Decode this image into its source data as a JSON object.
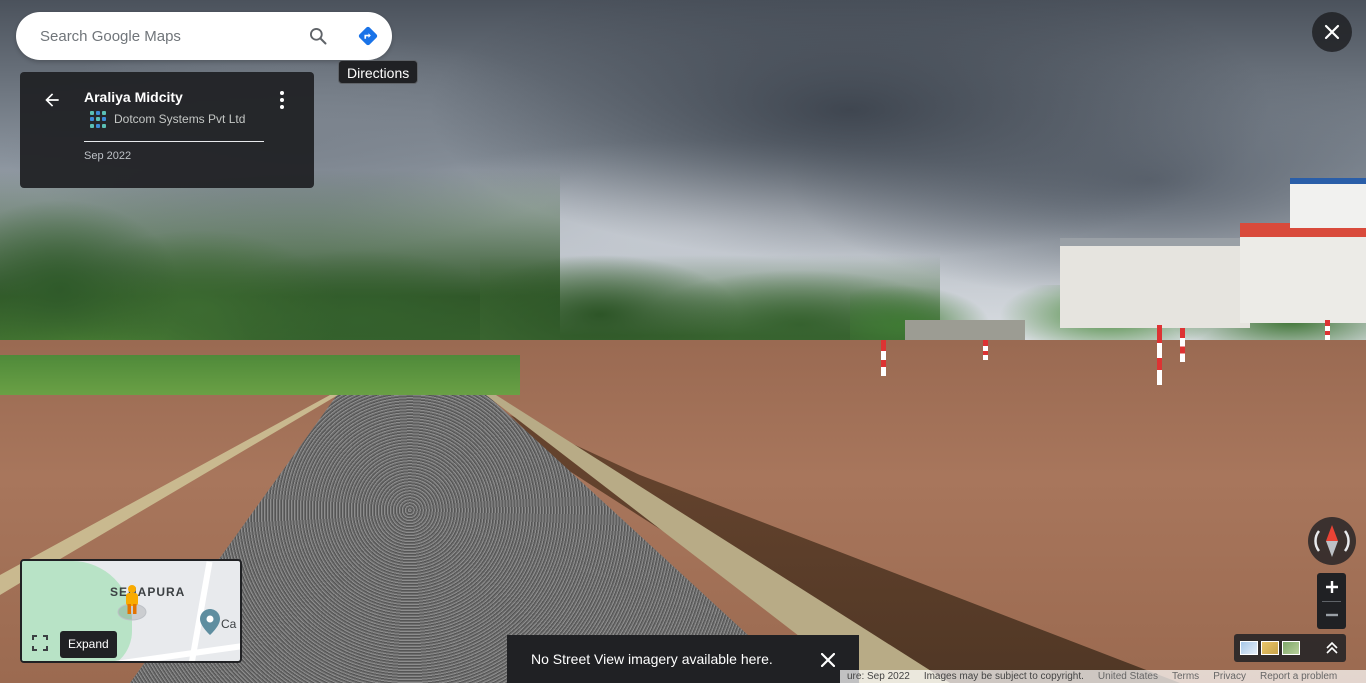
{
  "search": {
    "placeholder": "Search Google Maps"
  },
  "tooltips": {
    "directions": "Directions",
    "expand": "Expand"
  },
  "place_card": {
    "title": "Araliya Midcity",
    "provider": "Dotcom Systems Pvt Ltd",
    "capture_date": "Sep 2022"
  },
  "minimap": {
    "area_label": "SENAPURA",
    "poi_label": "Ca"
  },
  "toast": {
    "message": "No Street View imagery available here."
  },
  "footer": {
    "capture": "ure: Sep 2022",
    "copyright": "Images may be subject to copyright.",
    "region": "United States",
    "terms": "Terms",
    "privacy": "Privacy",
    "report": "Report a problem"
  },
  "colors": {
    "dark_panel": "#202124",
    "directions_blue": "#1a73e8",
    "compass_red": "#ea4335"
  },
  "icons": {
    "search": "search-icon",
    "directions": "directions-icon",
    "back": "arrow-back-icon",
    "more": "more-vert-icon",
    "close": "close-icon",
    "compass": "compass-icon",
    "zoom_in": "plus-icon",
    "zoom_out": "minus-icon",
    "expand": "fullscreen-icon",
    "pegman": "pegman-icon",
    "place_pin": "map-pin-icon",
    "layers_chevron": "chevron-up-icon"
  }
}
